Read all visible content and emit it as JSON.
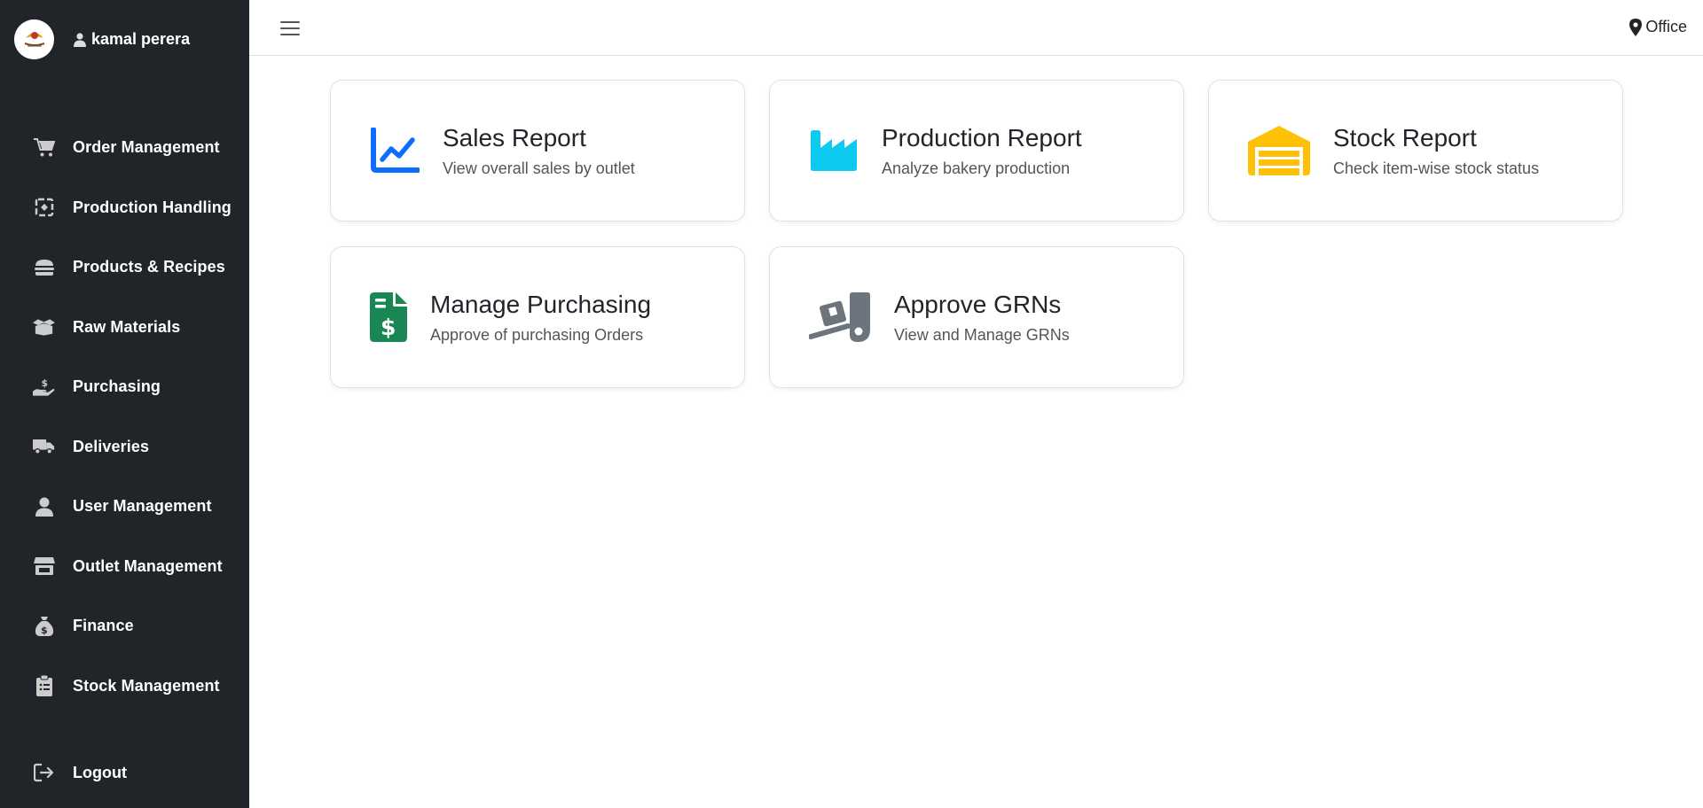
{
  "sidebar": {
    "user_name": "kamal perera",
    "items": [
      {
        "label": "Order Management",
        "icon": "cart-icon"
      },
      {
        "label": "Production Handling",
        "icon": "production-handling-icon"
      },
      {
        "label": "Products & Recipes",
        "icon": "burger-icon"
      },
      {
        "label": "Raw Materials",
        "icon": "box-open-icon"
      },
      {
        "label": "Purchasing",
        "icon": "hand-dollar-icon"
      },
      {
        "label": "Deliveries",
        "icon": "truck-icon"
      },
      {
        "label": "User Management",
        "icon": "user-icon"
      },
      {
        "label": "Outlet Management",
        "icon": "store-icon"
      },
      {
        "label": "Finance",
        "icon": "money-bag-icon"
      },
      {
        "label": "Stock Management",
        "icon": "clipboard-list-icon"
      }
    ],
    "logout_label": "Logout"
  },
  "topbar": {
    "location": "Office"
  },
  "cards": [
    {
      "title": "Sales Report",
      "desc": "View overall sales by outlet",
      "icon": "line-chart-icon",
      "color": "#0d6efd"
    },
    {
      "title": "Production Report",
      "desc": "Analyze bakery production",
      "icon": "industry-icon",
      "color": "#0dcaf0"
    },
    {
      "title": "Stock Report",
      "desc": "Check item-wise stock status",
      "icon": "warehouse-icon",
      "color": "#ffc107"
    },
    {
      "title": "Manage Purchasing",
      "desc": "Approve of purchasing Orders",
      "icon": "file-invoice-dollar-icon",
      "color": "#198754"
    },
    {
      "title": "Approve GRNs",
      "desc": "View and Manage GRNs",
      "icon": "dolly-icon",
      "color": "#6c757d"
    }
  ],
  "colors": {
    "sidebar_bg": "#212529",
    "border": "#dee2e6"
  }
}
